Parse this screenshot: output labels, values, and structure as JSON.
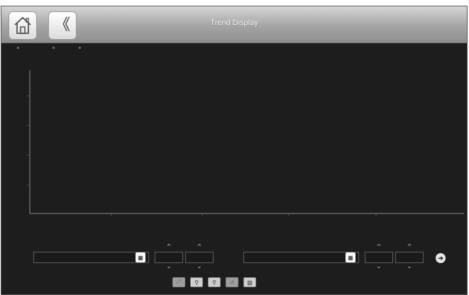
{
  "header": {
    "title": "Trend Display",
    "home_icon": "home-icon",
    "back_glyph": "《"
  },
  "footer": {
    "calendar_glyph": "▦",
    "go_glyph": "➔",
    "up_glyph": "^",
    "down_glyph": "⌄",
    "tools": [
      "zoom-fit-icon",
      "zoom-in-icon",
      "zoom-out-icon",
      "zoom-reset-icon",
      "export-image-icon"
    ]
  },
  "colors": {
    "background": "#1d1d1d",
    "axis": "#8a8a8a",
    "header_top": "#d6d6d6",
    "header_bottom": "#8f8f8f"
  }
}
